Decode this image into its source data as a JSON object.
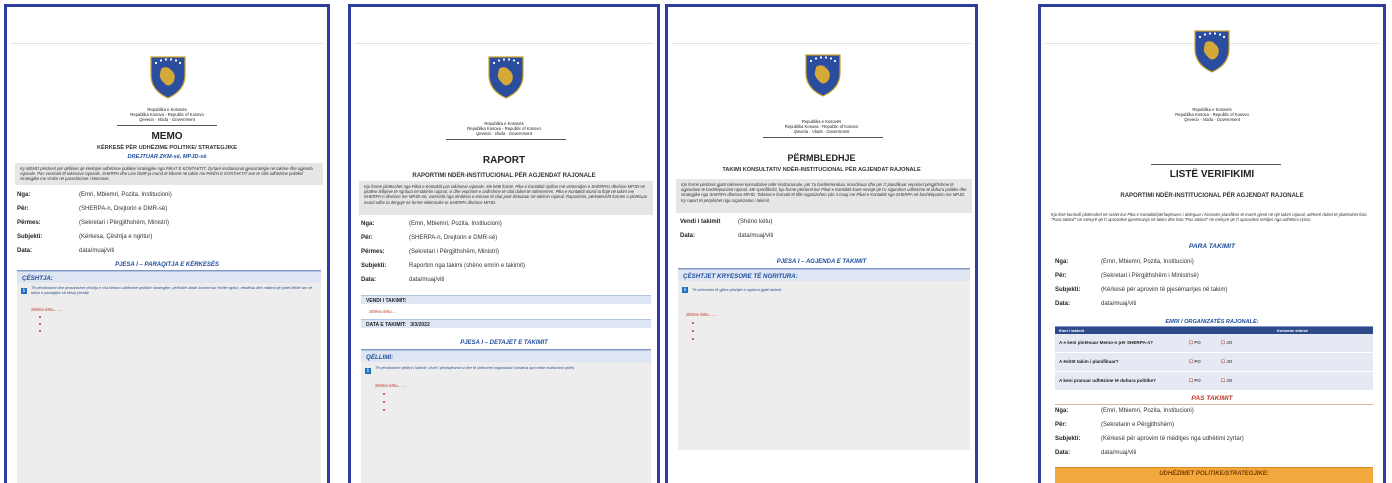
{
  "header": {
    "line1": "Republika e Kosovës",
    "line2": "Republika Kosova - Republic of Kosovo",
    "line3": "Qeveria - Vlada - Government"
  },
  "memo": {
    "title": "MEMO",
    "subtitle": "KËRKESË PËR UDHËZIME POLITIKE/ STRATEGJIKE",
    "line": "DREJTUAR ZKM-së, MPJD-së",
    "intro": "Ky MEMO përdoret për qëllimet që kërkojnë udhëzime politike/ strategjike nga PIKAT E KONTAKTIT. Zyrtarë institucional gjeostratëgie në takime dhe agjenda rajonale. Pas verzionit të takesave rajonale, SHERPA dhe Lise DMR-ja mund të kthenë në takim me PIKËN E KONTAKTIT ose të cilët udhëzime politike/ strategjike me sintim në parashtrimet i këtesave.",
    "fields": [
      {
        "label": "Nga:",
        "value": "(Emri, Mbiemri, Pozita, Institucioni)"
      },
      {
        "label": "Për:",
        "value": "(SHERPA-n, Drejtorin e DMR-së)"
      },
      {
        "label": "Përmes:",
        "value": "(Sekretari i Përgjithshëm, Ministri)"
      },
      {
        "label": "Subjekti:",
        "value": "(Kërkesa, Çështja e ngritur)"
      },
      {
        "label": "Data:",
        "value": "data/muaj/viti"
      }
    ],
    "section": "PJESA I – PARAQITJA E KËRKESËS",
    "panel_title": "ÇËSHTJA:",
    "panel_info": "Të përshkruhet dhe prezantohet çështja e cila kërkon udhëzime politike/ strategjike, përfshirë afatin kohore kur është ngritur, rëndësia dhe ndikimi që pritet kërkë ato në takim e paraqitjes së kësaj çështje",
    "placeholder": "Shëno këtu……"
  },
  "raport": {
    "title": "RAPORT",
    "subtitle": "RAPORTIMI NDËR-INSTITUCIONAL PËR AGJENDAT RAJONALE",
    "intro": "Kjo formë plotësohet nga Pikat e Kontaktit pas takimeve rajonale. Me këtë formë, Pika e Kontaktit njofton më vëmendjen e SHERPAs dhe/ose MPJD-së plotëse lidhjeve të ngritura në takimin rajonal, si dhe veprimet e ardhshme të cilat duhet të ndërmerren. Pika e Kontaktit mund ta ftojë në takim me SHERPA-n dhe/ose me MPJD-në, varësisht nga rëndësia e temave të cilat janë diskutuar në takimin rajonal. Raportimin, përkatësisht formën e plotësuar mund edhe ta dërgojë në formë elektronike te SHERPA dhe/ose MPJD.",
    "fields": [
      {
        "label": "Nga:",
        "value": "(Emri, Mbiemri, Pozita, Institucioni)"
      },
      {
        "label": "Për:",
        "value": "(SHERPA-n, Drejtorin e DMR-së)"
      },
      {
        "label": "Përmes:",
        "value": "(Sekretari i Përgjithshëm, Ministri)"
      },
      {
        "label": "Subjekti:",
        "value": "Raportim nga takimi (shëno emrin e takimit)"
      },
      {
        "label": "Data:",
        "value": "data/muaj/viti"
      }
    ],
    "venue_label": "VENDI I TAKIMIT:",
    "venue_value": "Shëno këtu…",
    "date_label": "DATA E TAKIMIT:",
    "date_value": "3/3/2022",
    "section": "PJESA I – DETAJET E TAKIMIT",
    "panel_title": "QËLLIMI:",
    "panel_info": "Të përshkruhet qëllimi i takimit, niveli i përfaqësimit si dhe të shënohet organizata/ iniciativa apo edhe institucioni pritës",
    "placeholder": "Shëno këtu……"
  },
  "permbledhje": {
    "title": "PËRMBLEDHJE",
    "subtitle": "TAKIMI KONSULTATIV NDËR-INSTITUCIONAL PËR AGJENDAT RAJONALE",
    "intro": "Kjo formë përdoret gjatë takimeve konsultative ndër-institucionale, për t'u bashkërenduar, koordinuar dhe për t'i planifikuar veprimet përgjithshme të agjendave të bashkëpunimit rajonal. Më specifikisht, kjo formë përdoret kur Pikat e Kontaktit kanë nevojë që t'u sigurohen udhëzime të duhura politike dhe strategjike nga SHERPA dhe/ose MPJD. Takimet e formatit të tillë organizohen çdo 3 muaj me Pikat e Kontaktit nga SHERPA në bashkëpunim me MPJD. Ky raport të përpilohet nga organizatori i takimit.",
    "fields": [
      {
        "label": "Vendi i takimit",
        "value": "(Shëno këtu)"
      },
      {
        "label": "Data:",
        "value": "data/muaj/viti"
      }
    ],
    "section": "PJESA I – AGJENDA E TAKIMIT",
    "panel_title": "ÇËSHTJET KRYESORE TË NGRITURA:",
    "panel_info": "Të shënohen të gjitha çështjet e ngritura gjatë takimit",
    "placeholder": "Shëno këtu……"
  },
  "liste": {
    "title": "LISTË VERIFIKIMI",
    "subtitle": "RAPORTIMI NDËR-INSTITUCIONAL PËR AGJENDAT RAJONALE",
    "intro": "Kjo listë kontrolli plotësohet në rastet kur Pika e Kontaktit/përfaqësuesi i deleguar i Kosovës planifikon të marrë pjesë në një takim rajonal, atëherë duhet të plotësohet lista \"Para takimit\" në mënyrë që t'i aprovohet pjesëmarrja në takim dhe lista \"Pas takimit\" në mënyrë që t'i aprovohet mëdjes nga udhëtimi zyrtar.",
    "before_section": "PARA TAKIMIT",
    "before_fields": [
      {
        "label": "Nga:",
        "value": "(Emri, Mbiemri, Pozita, Institucioni)"
      },
      {
        "label": "Për:",
        "value": "(Sekretari i Përgjithshëm i Ministrisë)"
      },
      {
        "label": "Subjekti:",
        "value": "(Kërkesë për aprovim të pjesëmarrjes në takim)"
      },
      {
        "label": "Data:",
        "value": "data/muaj/viti"
      }
    ],
    "org_section": "EMRI I ORGANIZATËS RAJONALE:",
    "table_headers": [
      "Emri i takimit",
      "",
      "Komente shtesë"
    ],
    "table_rows": [
      {
        "q": "A e keni plotësuar Memo-n për SHERPA-n?",
        "yes": "PO",
        "no": "JO"
      },
      {
        "q": "A është takim i planifikuar?",
        "yes": "PO",
        "no": "JO"
      },
      {
        "q": "A keni pranuar udhëzime të duhura politike?",
        "yes": "PO",
        "no": "JO"
      }
    ],
    "after_section": "PAS TAKIMIT",
    "after_fields": [
      {
        "label": "Nga:",
        "value": "(Emri, Mbiemri, Pozita, Institucioni)"
      },
      {
        "label": "Për:",
        "value": "(Sekretarin e Përgjithshëm)"
      },
      {
        "label": "Subjekti:",
        "value": "(Kërkesë për aprovim të mëdițjes nga udhëtimi zyrtar)"
      },
      {
        "label": "Data:",
        "value": "data/muaj/viti"
      }
    ],
    "orange_title": "UDHËZIMET POLITIKE/STRATEGJIKE:"
  }
}
